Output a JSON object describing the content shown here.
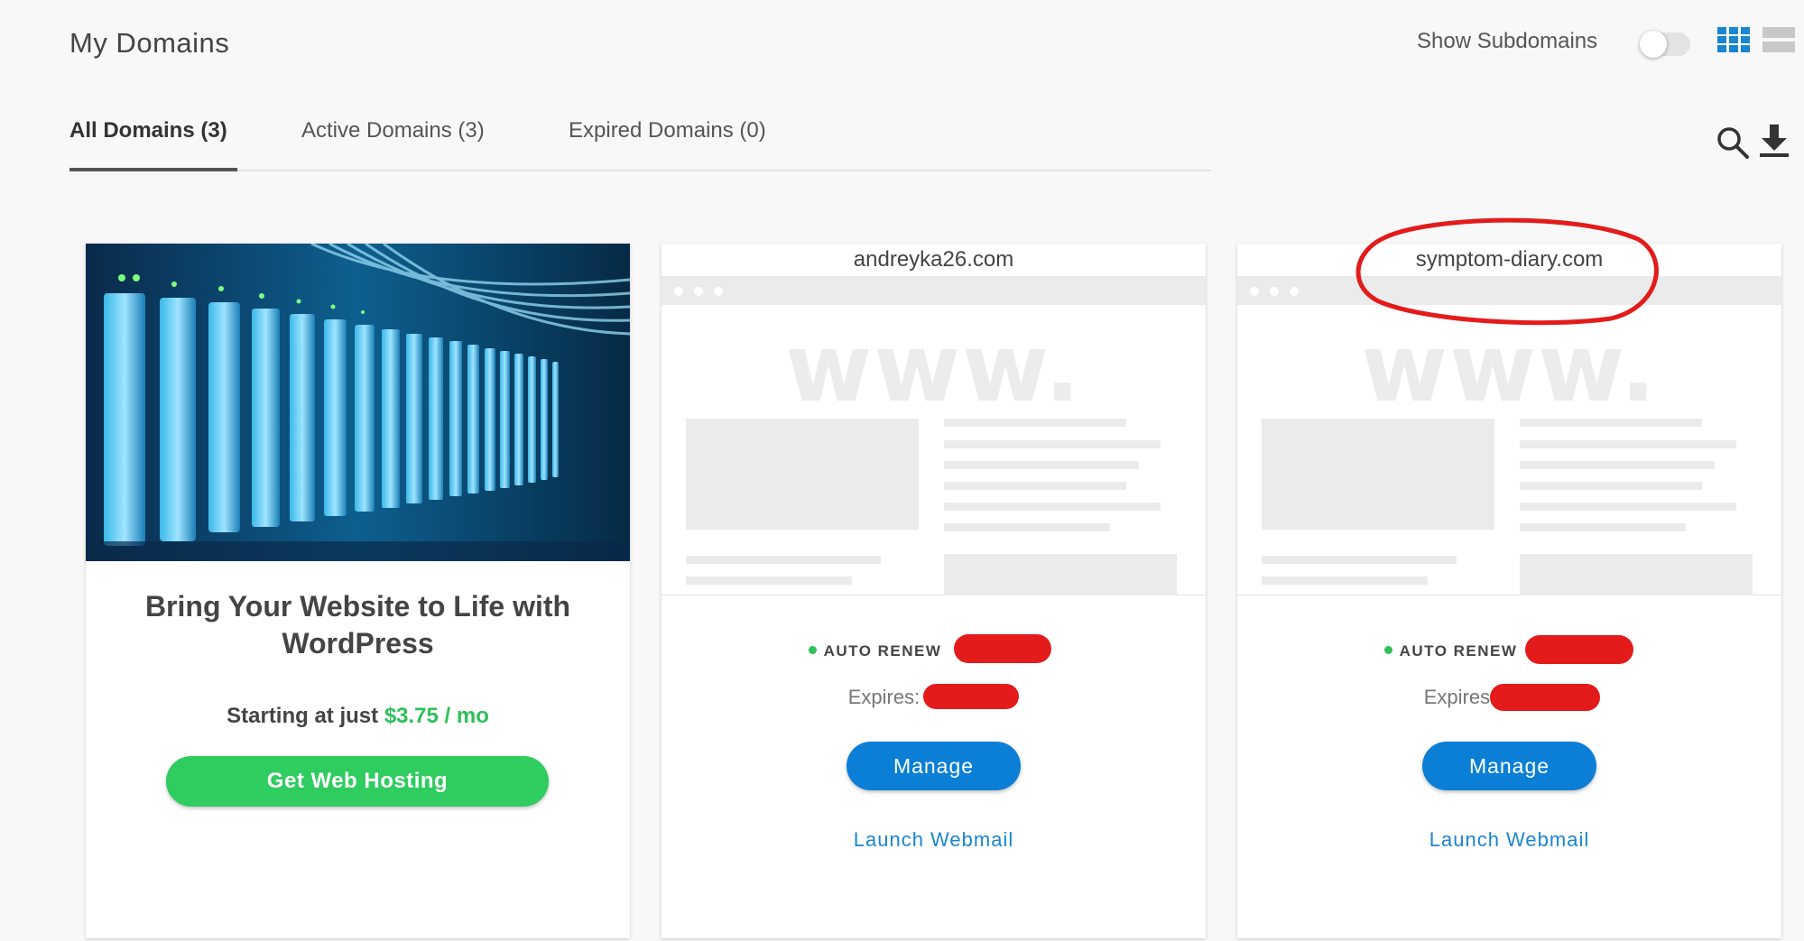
{
  "header": {
    "title": "My Domains",
    "show_subdomains_label": "Show Subdomains",
    "show_subdomains_on": false,
    "view_icons": [
      "grid-view-icon",
      "list-view-icon"
    ],
    "accent_color": "#1a85d0"
  },
  "tabs": [
    {
      "label": "All Domains (3)",
      "active": true
    },
    {
      "label": "Active Domains (3)",
      "active": false
    },
    {
      "label": "Expired Domains (0)",
      "active": false
    }
  ],
  "toolbar": {
    "icons": [
      "search-icon",
      "download-icon"
    ]
  },
  "promo": {
    "title": "Bring Your Website to Life with WordPress",
    "price_prefix": "Starting at just",
    "price": "$3.75 / mo",
    "button_label": "Get Web Hosting",
    "button_color": "#2fcc5f"
  },
  "domains": [
    {
      "name": "andreyka26.com",
      "preview_text": "www.",
      "status": "AUTO RENEW",
      "expires_label": "Expires:",
      "manage_label": "Manage",
      "webmail_label": "Launch Webmail"
    },
    {
      "name": "symptom-diary.com",
      "preview_text": "www.",
      "status": "AUTO RENEW",
      "expires_label": "Expires:",
      "manage_label": "Manage",
      "webmail_label": "Launch Webmail"
    }
  ]
}
